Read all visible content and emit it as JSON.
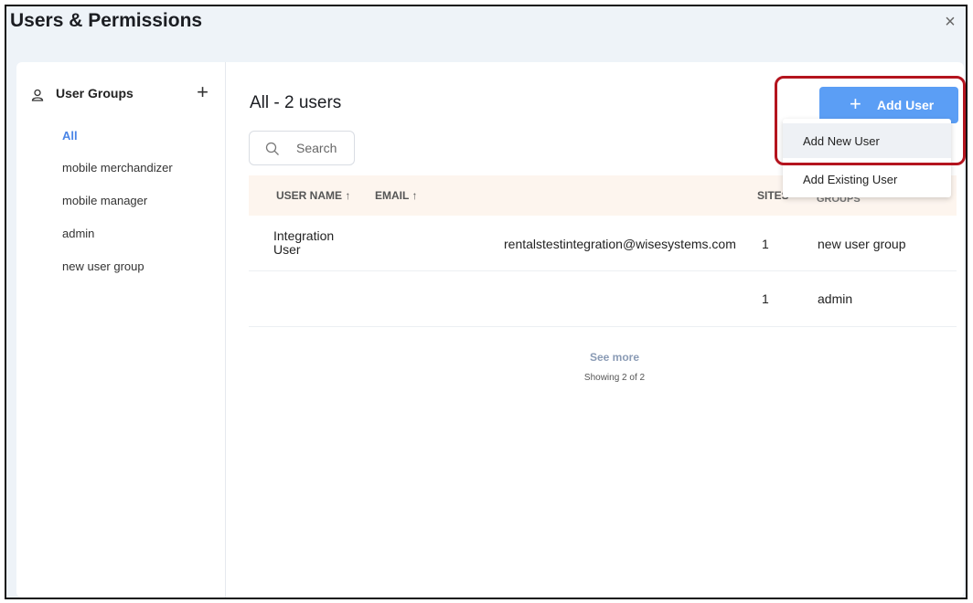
{
  "window": {
    "title": "Users & Permissions",
    "close_glyph": "×"
  },
  "sidebar": {
    "title": "User Groups",
    "add_glyph": "+",
    "items": [
      {
        "label": "All",
        "active": true
      },
      {
        "label": "mobile merchandizer",
        "active": false
      },
      {
        "label": "mobile manager",
        "active": false
      },
      {
        "label": "admin",
        "active": false
      },
      {
        "label": "new user group",
        "active": false
      }
    ]
  },
  "main": {
    "heading": "All - 2 users",
    "search": {
      "placeholder": "Search",
      "value": ""
    },
    "add_user": {
      "glyph": "+",
      "label": "Add User"
    },
    "table": {
      "columns": {
        "user_name": "USER NAME ↑",
        "email": "EMAIL ↑",
        "sites": "SITES",
        "groups": "GROUPS"
      },
      "rows": [
        {
          "name": "Integration User",
          "email": "rentalstestintegration@wisesystems.com",
          "sites": "1",
          "groups": "new user group"
        },
        {
          "name": "",
          "email": "",
          "sites": "1",
          "groups": "admin"
        }
      ]
    },
    "see_more": "See more",
    "showing": "Showing 2 of 2"
  },
  "dropdown": {
    "items": [
      {
        "label": "Add New User",
        "hovered": true
      },
      {
        "label": "Add Existing User",
        "hovered": false
      }
    ]
  },
  "colors": {
    "accent": "#5b9ef5",
    "active_link": "#4a85e6",
    "highlight_border": "#b4141e",
    "header_bg": "#fdf5ee"
  }
}
